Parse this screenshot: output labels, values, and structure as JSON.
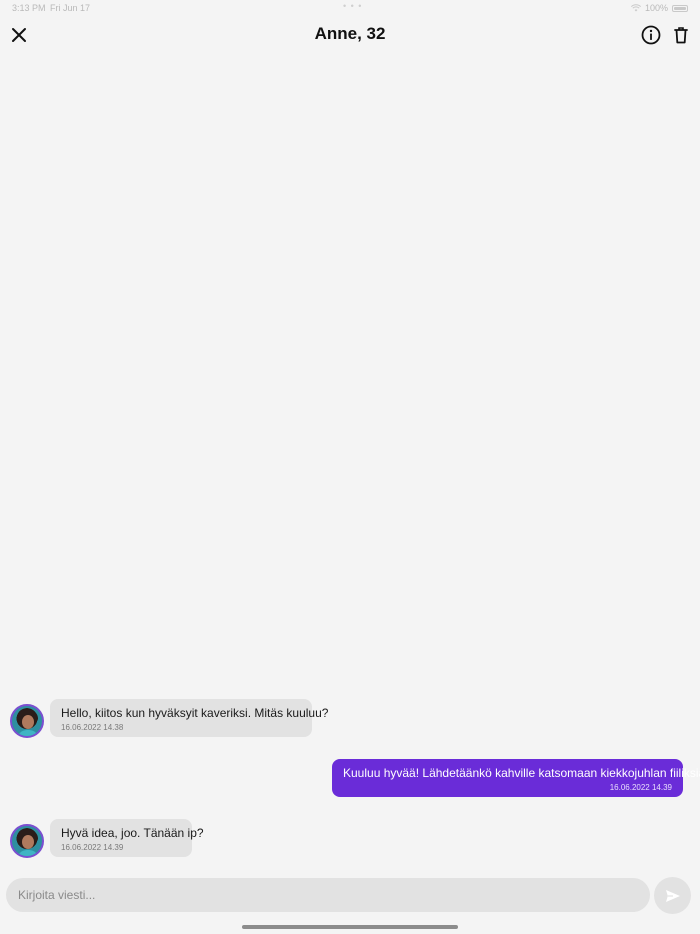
{
  "status_bar": {
    "time": "3:13 PM",
    "date": "Fri Jun 17",
    "dots": "• • •",
    "battery": "100%"
  },
  "header": {
    "title": "Anne, 32",
    "icons": {
      "close": "close-icon",
      "info": "info-icon",
      "delete": "trash-icon"
    }
  },
  "messages": [
    {
      "direction": "incoming",
      "text": "Hello, kiitos kun hyväksyit kaveriksi. Mitäs kuuluu?",
      "timestamp": "16.06.2022 14.38"
    },
    {
      "direction": "outgoing",
      "text": "Kuuluu hyvää! Lähdetäänkö kahville katsomaan kiekkojuhlan fiiliksiä?",
      "timestamp": "16.06.2022 14.39"
    },
    {
      "direction": "incoming",
      "text": "Hyvä idea, joo. Tänään ip?",
      "timestamp": "16.06.2022 14.39"
    }
  ],
  "composer": {
    "placeholder": "Kirjoita viesti...",
    "value": "",
    "send_icon": "send-icon"
  },
  "colors": {
    "background": "#f4f4f4",
    "incoming_bubble": "#e2e2e2",
    "outgoing_bubble": "#6a2cd8",
    "text": "#1a1a1a"
  }
}
